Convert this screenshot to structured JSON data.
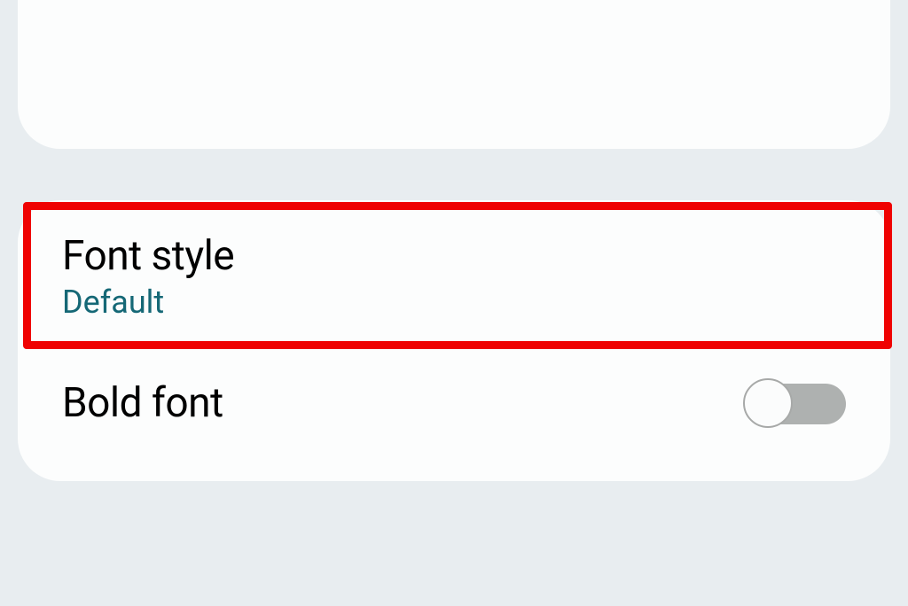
{
  "settings": {
    "fontStyle": {
      "title": "Font style",
      "value": "Default"
    },
    "boldFont": {
      "title": "Bold font",
      "enabled": false
    }
  }
}
